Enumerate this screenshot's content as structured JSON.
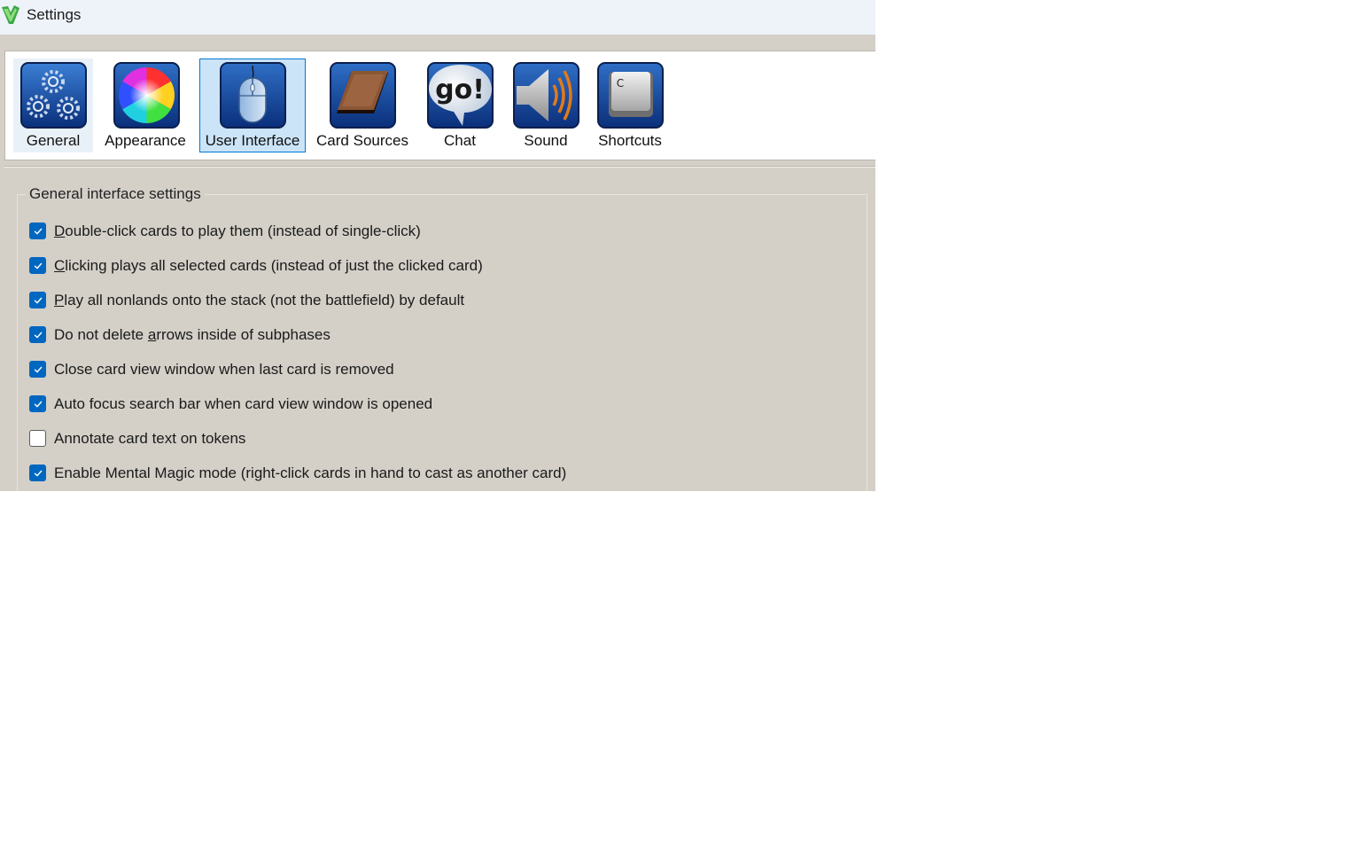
{
  "window": {
    "title": "Settings"
  },
  "tabs": [
    {
      "label": "General",
      "icon": "gears-icon",
      "state": "hover"
    },
    {
      "label": "Appearance",
      "icon": "color-wheel-icon",
      "state": "normal"
    },
    {
      "label": "User Interface",
      "icon": "mouse-icon",
      "state": "active"
    },
    {
      "label": "Card Sources",
      "icon": "card-icon",
      "state": "normal"
    },
    {
      "label": "Chat",
      "icon": "speech-bubble-icon",
      "state": "normal"
    },
    {
      "label": "Sound",
      "icon": "speaker-icon",
      "state": "normal"
    },
    {
      "label": "Shortcuts",
      "icon": "keyboard-key-icon",
      "state": "normal"
    }
  ],
  "shortcut_key_glyph": "C",
  "chat_icon_text": "go!",
  "group": {
    "title": "General interface settings",
    "options": [
      {
        "label": "Double-click cards to play them (instead of single-click)",
        "checked": true,
        "mnemonic_index": 0
      },
      {
        "label": "Clicking plays all selected cards (instead of just the clicked card)",
        "checked": true,
        "mnemonic_index": 0
      },
      {
        "label": "Play all nonlands onto the stack (not the battlefield) by default",
        "checked": true,
        "mnemonic_index": 0
      },
      {
        "label": "Do not delete arrows inside of subphases",
        "checked": true,
        "mnemonic_index": 14
      },
      {
        "label": "Close card view window when last card is removed",
        "checked": true,
        "mnemonic_index": -1
      },
      {
        "label": "Auto focus search bar when card view window is opened",
        "checked": true,
        "mnemonic_index": -1
      },
      {
        "label": "Annotate card text on tokens",
        "checked": false,
        "mnemonic_index": -1
      },
      {
        "label": "Enable Mental Magic mode (right-click cards in hand to cast as another card)",
        "checked": true,
        "mnemonic_index": -1
      }
    ]
  },
  "colors": {
    "accent": "#0067c0",
    "window_bg": "#d4d0c8",
    "icon_blue": "#0a3f8f",
    "active_tab_bg": "#cce4f7"
  }
}
